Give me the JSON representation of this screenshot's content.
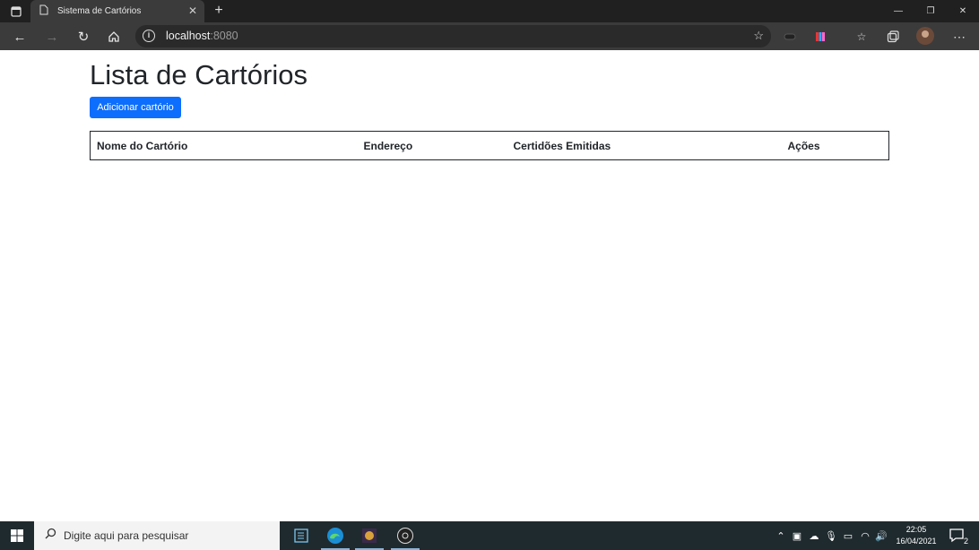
{
  "browser": {
    "tab_title": "Sistema de Cartórios",
    "address_host": "localhost",
    "address_port": ":8080"
  },
  "page": {
    "title": "Lista de Cartórios",
    "add_button": "Adicionar cartório",
    "table_headers": [
      "Nome do Cartório",
      "Endereço",
      "Certidões Emitidas",
      "Ações"
    ]
  },
  "taskbar": {
    "search_placeholder": "Digite aqui para pesquisar",
    "time": "22:05",
    "date": "16/04/2021",
    "notification_count": "2"
  },
  "colors": {
    "primary": "#0d6efd",
    "browser_dark": "#202020",
    "toolbar": "#3b3b3b",
    "taskbar": "#1f2a2e"
  }
}
